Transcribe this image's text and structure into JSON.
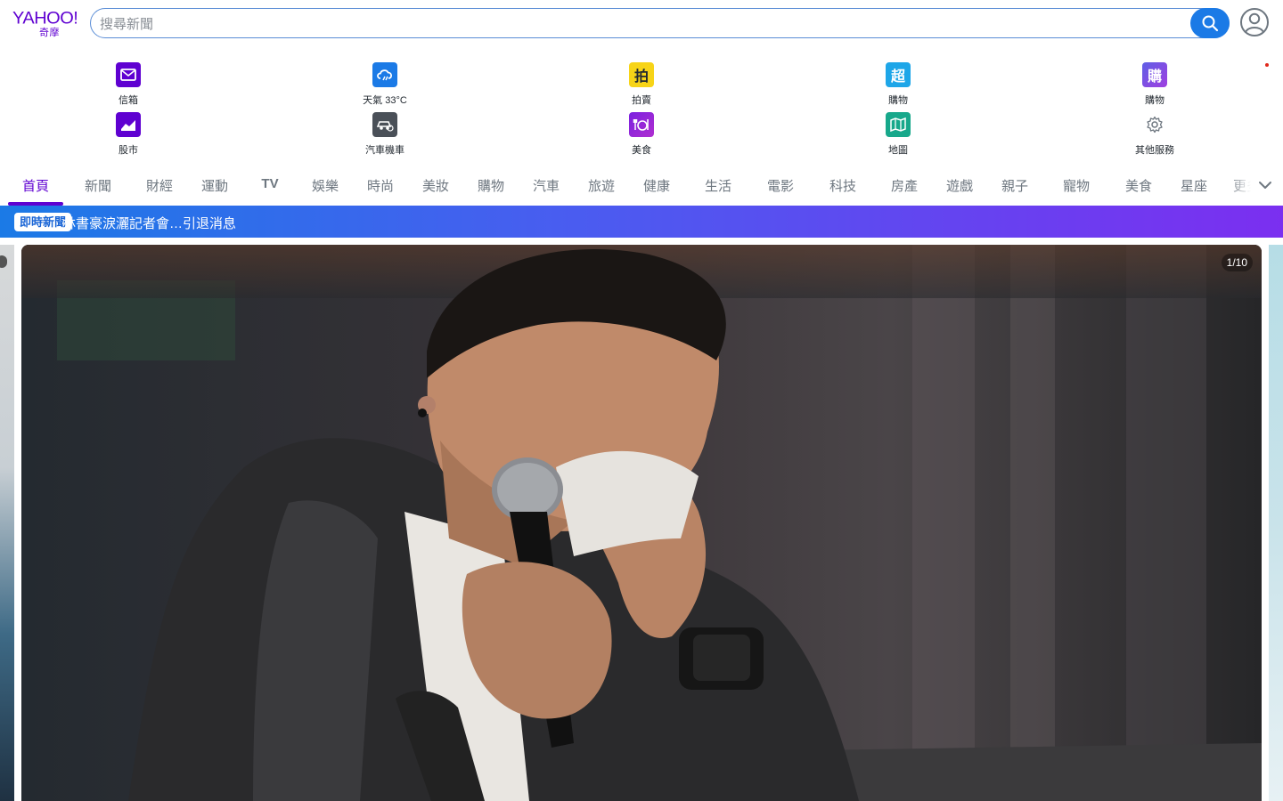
{
  "header": {
    "logo_text": "YAHOO!",
    "logo_sub": "奇摩",
    "search_placeholder": "搜尋新聞",
    "account_icon": "user-circle-icon"
  },
  "apps": [
    {
      "label": "信箱",
      "icon": "mail-icon",
      "color": "#5f01d1"
    },
    {
      "label": "天氣 33°C",
      "icon": "weather-cloud-icon",
      "color": "#1b7ae6"
    },
    {
      "label": "拍賣",
      "icon": "auction-icon",
      "color": "#f7d417"
    },
    {
      "label": "購物",
      "icon": "shopping-icon",
      "color": "#1ea6e8"
    },
    {
      "label": "購物",
      "icon": "store-icon",
      "color": "#7a3fe0"
    },
    {
      "label": "股市",
      "icon": "stock-chart-icon",
      "color": "#5f01d1"
    },
    {
      "label": "汽車機車",
      "icon": "car-icon",
      "color": "#4a5058"
    },
    {
      "label": "美食",
      "icon": "dining-icon",
      "color": "#8a2be2"
    },
    {
      "label": "地圖",
      "icon": "map-icon",
      "color": "#17a88b"
    },
    {
      "label": "其他服務",
      "icon": "gear-icon",
      "color": "#6e7780"
    }
  ],
  "tabs": [
    "首頁",
    "新聞",
    "財經",
    "運動",
    "TV",
    "娛樂",
    "時尚",
    "美妝",
    "購物",
    "汽車",
    "旅遊",
    "健康",
    "生活",
    "電影",
    "科技",
    "房產",
    "遊戲",
    "親子",
    "寵物",
    "美食",
    "星座",
    "更多"
  ],
  "banner": {
    "badge": "即時新聞",
    "headline": "林書豪淚灑記者會…引退消息"
  },
  "carousel": {
    "counter": "1/10"
  }
}
